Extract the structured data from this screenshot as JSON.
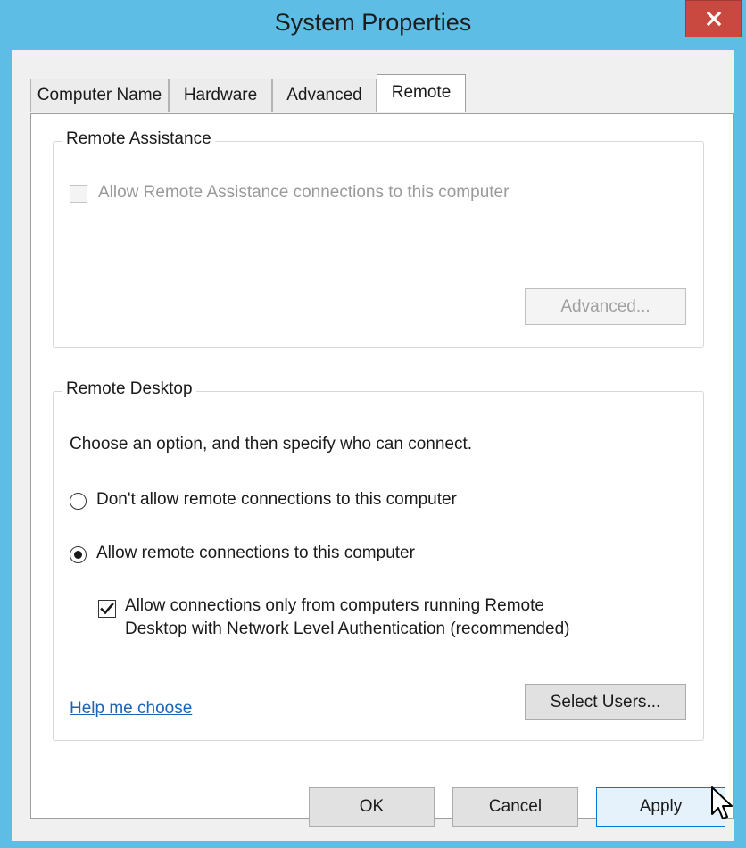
{
  "window": {
    "title": "System Properties",
    "close_glyph": "×",
    "accent_color": "#5ebde4"
  },
  "tabs": [
    {
      "label": "Computer Name",
      "active": false
    },
    {
      "label": "Hardware",
      "active": false
    },
    {
      "label": "Advanced",
      "active": false
    },
    {
      "label": "Remote",
      "active": true
    }
  ],
  "remote_assistance": {
    "legend": "Remote Assistance",
    "allow_label": "Allow Remote Assistance connections to this computer",
    "allow_checked": false,
    "allow_enabled": false,
    "advanced_button": "Advanced..."
  },
  "remote_desktop": {
    "legend": "Remote Desktop",
    "instruction": "Choose an option, and then specify who can connect.",
    "option_dont_allow": "Don't allow remote connections to this computer",
    "option_allow": "Allow remote connections to this computer",
    "selected_option": "allow",
    "nla_line1": "Allow connections only from computers running Remote",
    "nla_line2": "Desktop with Network Level Authentication (recommended)",
    "nla_checked": true,
    "help_link": "Help me choose",
    "select_users_button": "Select Users..."
  },
  "footer": {
    "ok": "OK",
    "cancel": "Cancel",
    "apply": "Apply"
  },
  "icons": {
    "close": "close-icon",
    "checkmark": "checkmark-icon",
    "cursor": "mouse-pointer-icon"
  }
}
